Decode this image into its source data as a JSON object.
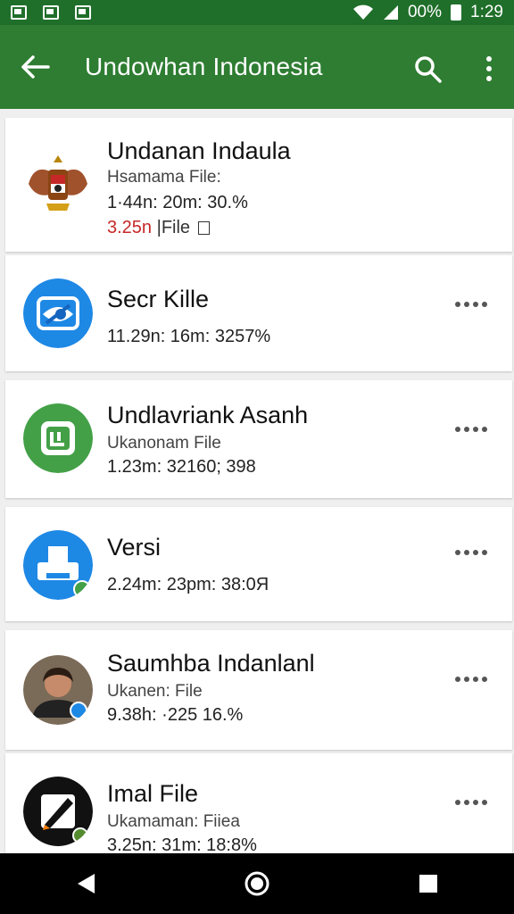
{
  "status_bar": {
    "battery_text": "00%",
    "time": "1:29"
  },
  "app_bar": {
    "title": "Undowhan Indonesia",
    "color": "#2e7d32"
  },
  "items": [
    {
      "name": "Undanan Indaula",
      "subtitle": "Hsamama File:",
      "meta": "1·44n: 20m: 30.%",
      "size": "3.25n",
      "file_tag": "|File",
      "icon": "garuda-emblem-icon"
    },
    {
      "name": "Secr Kille",
      "meta": "11.29n: 16m: 3257%",
      "icon": "blue-eye-share-icon"
    },
    {
      "name": "Undlavriank Asanh",
      "subtitle": "Ukanonam File",
      "meta": "1.23m: 32160; 398",
      "icon": "green-document-icon"
    },
    {
      "name": "Versi",
      "meta": "2.24m: 23pm: 38:0Я",
      "icon": "blue-printer-icon"
    },
    {
      "name": "Saumhba Indanlanl",
      "subtitle": "Ukanen: File",
      "meta": "9.38h: ·225 16.%",
      "icon": "person-photo-avatar"
    },
    {
      "name": "Imal File",
      "subtitle": "Ukamaman: Fiiea",
      "meta": "3.25n: 31m: 18:8%",
      "icon": "black-pencil-icon"
    }
  ]
}
